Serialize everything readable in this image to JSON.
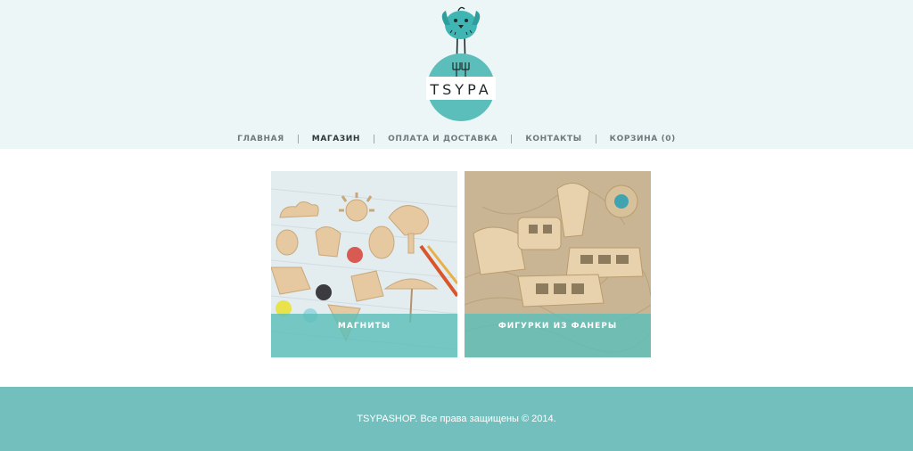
{
  "header": {
    "logo_text": "TSYPA",
    "nav": [
      {
        "label": "ГЛАВНАЯ"
      },
      {
        "label": "МАГАЗИН"
      },
      {
        "label": "ОПЛАТА И ДОСТАВКА"
      },
      {
        "label": "КОНТАКТЫ"
      },
      {
        "label": "КОРЗИНА (0)"
      }
    ],
    "active_nav": "МАГАЗИН"
  },
  "categories": [
    {
      "label": "МАГНИТЫ",
      "image": "wooden-magnets-photo"
    },
    {
      "label": "ФИГУРКИ ИЗ ФАНЕРЫ",
      "image": "plywood-figures-photo"
    }
  ],
  "footer": {
    "copyright": "TSYPASHOP. Все права защищены © 2014."
  },
  "colors": {
    "accent": "#5cbeba",
    "header_bg": "#edf6f7",
    "footer_bg": "#72bfbd",
    "bird": "#3fb5b4"
  }
}
